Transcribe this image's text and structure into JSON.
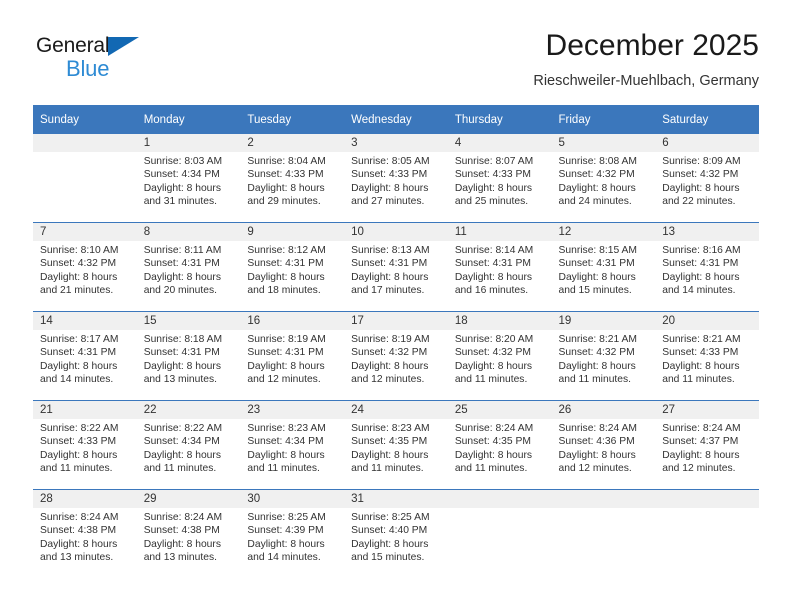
{
  "brand": {
    "name_top": "General",
    "name_bottom": "Blue"
  },
  "header": {
    "title": "December 2025",
    "subtitle": "Rieschweiler-Muehlbach, Germany"
  },
  "colors": {
    "header_blue": "#3b77bc",
    "logo_blue": "#2e8bd4",
    "triangle_blue": "#1268b3",
    "daynum_bg": "#f0f0f0"
  },
  "weekdays": [
    "Sunday",
    "Monday",
    "Tuesday",
    "Wednesday",
    "Thursday",
    "Friday",
    "Saturday"
  ],
  "weeks": [
    [
      {
        "day": "",
        "empty": true
      },
      {
        "day": "1",
        "sunrise": "Sunrise: 8:03 AM",
        "sunset": "Sunset: 4:34 PM",
        "daylight_1": "Daylight: 8 hours",
        "daylight_2": "and 31 minutes."
      },
      {
        "day": "2",
        "sunrise": "Sunrise: 8:04 AM",
        "sunset": "Sunset: 4:33 PM",
        "daylight_1": "Daylight: 8 hours",
        "daylight_2": "and 29 minutes."
      },
      {
        "day": "3",
        "sunrise": "Sunrise: 8:05 AM",
        "sunset": "Sunset: 4:33 PM",
        "daylight_1": "Daylight: 8 hours",
        "daylight_2": "and 27 minutes."
      },
      {
        "day": "4",
        "sunrise": "Sunrise: 8:07 AM",
        "sunset": "Sunset: 4:33 PM",
        "daylight_1": "Daylight: 8 hours",
        "daylight_2": "and 25 minutes."
      },
      {
        "day": "5",
        "sunrise": "Sunrise: 8:08 AM",
        "sunset": "Sunset: 4:32 PM",
        "daylight_1": "Daylight: 8 hours",
        "daylight_2": "and 24 minutes."
      },
      {
        "day": "6",
        "sunrise": "Sunrise: 8:09 AM",
        "sunset": "Sunset: 4:32 PM",
        "daylight_1": "Daylight: 8 hours",
        "daylight_2": "and 22 minutes."
      }
    ],
    [
      {
        "day": "7",
        "sunrise": "Sunrise: 8:10 AM",
        "sunset": "Sunset: 4:32 PM",
        "daylight_1": "Daylight: 8 hours",
        "daylight_2": "and 21 minutes."
      },
      {
        "day": "8",
        "sunrise": "Sunrise: 8:11 AM",
        "sunset": "Sunset: 4:31 PM",
        "daylight_1": "Daylight: 8 hours",
        "daylight_2": "and 20 minutes."
      },
      {
        "day": "9",
        "sunrise": "Sunrise: 8:12 AM",
        "sunset": "Sunset: 4:31 PM",
        "daylight_1": "Daylight: 8 hours",
        "daylight_2": "and 18 minutes."
      },
      {
        "day": "10",
        "sunrise": "Sunrise: 8:13 AM",
        "sunset": "Sunset: 4:31 PM",
        "daylight_1": "Daylight: 8 hours",
        "daylight_2": "and 17 minutes."
      },
      {
        "day": "11",
        "sunrise": "Sunrise: 8:14 AM",
        "sunset": "Sunset: 4:31 PM",
        "daylight_1": "Daylight: 8 hours",
        "daylight_2": "and 16 minutes."
      },
      {
        "day": "12",
        "sunrise": "Sunrise: 8:15 AM",
        "sunset": "Sunset: 4:31 PM",
        "daylight_1": "Daylight: 8 hours",
        "daylight_2": "and 15 minutes."
      },
      {
        "day": "13",
        "sunrise": "Sunrise: 8:16 AM",
        "sunset": "Sunset: 4:31 PM",
        "daylight_1": "Daylight: 8 hours",
        "daylight_2": "and 14 minutes."
      }
    ],
    [
      {
        "day": "14",
        "sunrise": "Sunrise: 8:17 AM",
        "sunset": "Sunset: 4:31 PM",
        "daylight_1": "Daylight: 8 hours",
        "daylight_2": "and 14 minutes."
      },
      {
        "day": "15",
        "sunrise": "Sunrise: 8:18 AM",
        "sunset": "Sunset: 4:31 PM",
        "daylight_1": "Daylight: 8 hours",
        "daylight_2": "and 13 minutes."
      },
      {
        "day": "16",
        "sunrise": "Sunrise: 8:19 AM",
        "sunset": "Sunset: 4:31 PM",
        "daylight_1": "Daylight: 8 hours",
        "daylight_2": "and 12 minutes."
      },
      {
        "day": "17",
        "sunrise": "Sunrise: 8:19 AM",
        "sunset": "Sunset: 4:32 PM",
        "daylight_1": "Daylight: 8 hours",
        "daylight_2": "and 12 minutes."
      },
      {
        "day": "18",
        "sunrise": "Sunrise: 8:20 AM",
        "sunset": "Sunset: 4:32 PM",
        "daylight_1": "Daylight: 8 hours",
        "daylight_2": "and 11 minutes."
      },
      {
        "day": "19",
        "sunrise": "Sunrise: 8:21 AM",
        "sunset": "Sunset: 4:32 PM",
        "daylight_1": "Daylight: 8 hours",
        "daylight_2": "and 11 minutes."
      },
      {
        "day": "20",
        "sunrise": "Sunrise: 8:21 AM",
        "sunset": "Sunset: 4:33 PM",
        "daylight_1": "Daylight: 8 hours",
        "daylight_2": "and 11 minutes."
      }
    ],
    [
      {
        "day": "21",
        "sunrise": "Sunrise: 8:22 AM",
        "sunset": "Sunset: 4:33 PM",
        "daylight_1": "Daylight: 8 hours",
        "daylight_2": "and 11 minutes."
      },
      {
        "day": "22",
        "sunrise": "Sunrise: 8:22 AM",
        "sunset": "Sunset: 4:34 PM",
        "daylight_1": "Daylight: 8 hours",
        "daylight_2": "and 11 minutes."
      },
      {
        "day": "23",
        "sunrise": "Sunrise: 8:23 AM",
        "sunset": "Sunset: 4:34 PM",
        "daylight_1": "Daylight: 8 hours",
        "daylight_2": "and 11 minutes."
      },
      {
        "day": "24",
        "sunrise": "Sunrise: 8:23 AM",
        "sunset": "Sunset: 4:35 PM",
        "daylight_1": "Daylight: 8 hours",
        "daylight_2": "and 11 minutes."
      },
      {
        "day": "25",
        "sunrise": "Sunrise: 8:24 AM",
        "sunset": "Sunset: 4:35 PM",
        "daylight_1": "Daylight: 8 hours",
        "daylight_2": "and 11 minutes."
      },
      {
        "day": "26",
        "sunrise": "Sunrise: 8:24 AM",
        "sunset": "Sunset: 4:36 PM",
        "daylight_1": "Daylight: 8 hours",
        "daylight_2": "and 12 minutes."
      },
      {
        "day": "27",
        "sunrise": "Sunrise: 8:24 AM",
        "sunset": "Sunset: 4:37 PM",
        "daylight_1": "Daylight: 8 hours",
        "daylight_2": "and 12 minutes."
      }
    ],
    [
      {
        "day": "28",
        "sunrise": "Sunrise: 8:24 AM",
        "sunset": "Sunset: 4:38 PM",
        "daylight_1": "Daylight: 8 hours",
        "daylight_2": "and 13 minutes."
      },
      {
        "day": "29",
        "sunrise": "Sunrise: 8:24 AM",
        "sunset": "Sunset: 4:38 PM",
        "daylight_1": "Daylight: 8 hours",
        "daylight_2": "and 13 minutes."
      },
      {
        "day": "30",
        "sunrise": "Sunrise: 8:25 AM",
        "sunset": "Sunset: 4:39 PM",
        "daylight_1": "Daylight: 8 hours",
        "daylight_2": "and 14 minutes."
      },
      {
        "day": "31",
        "sunrise": "Sunrise: 8:25 AM",
        "sunset": "Sunset: 4:40 PM",
        "daylight_1": "Daylight: 8 hours",
        "daylight_2": "and 15 minutes."
      },
      {
        "day": "",
        "empty": true
      },
      {
        "day": "",
        "empty": true
      },
      {
        "day": "",
        "empty": true
      }
    ]
  ]
}
